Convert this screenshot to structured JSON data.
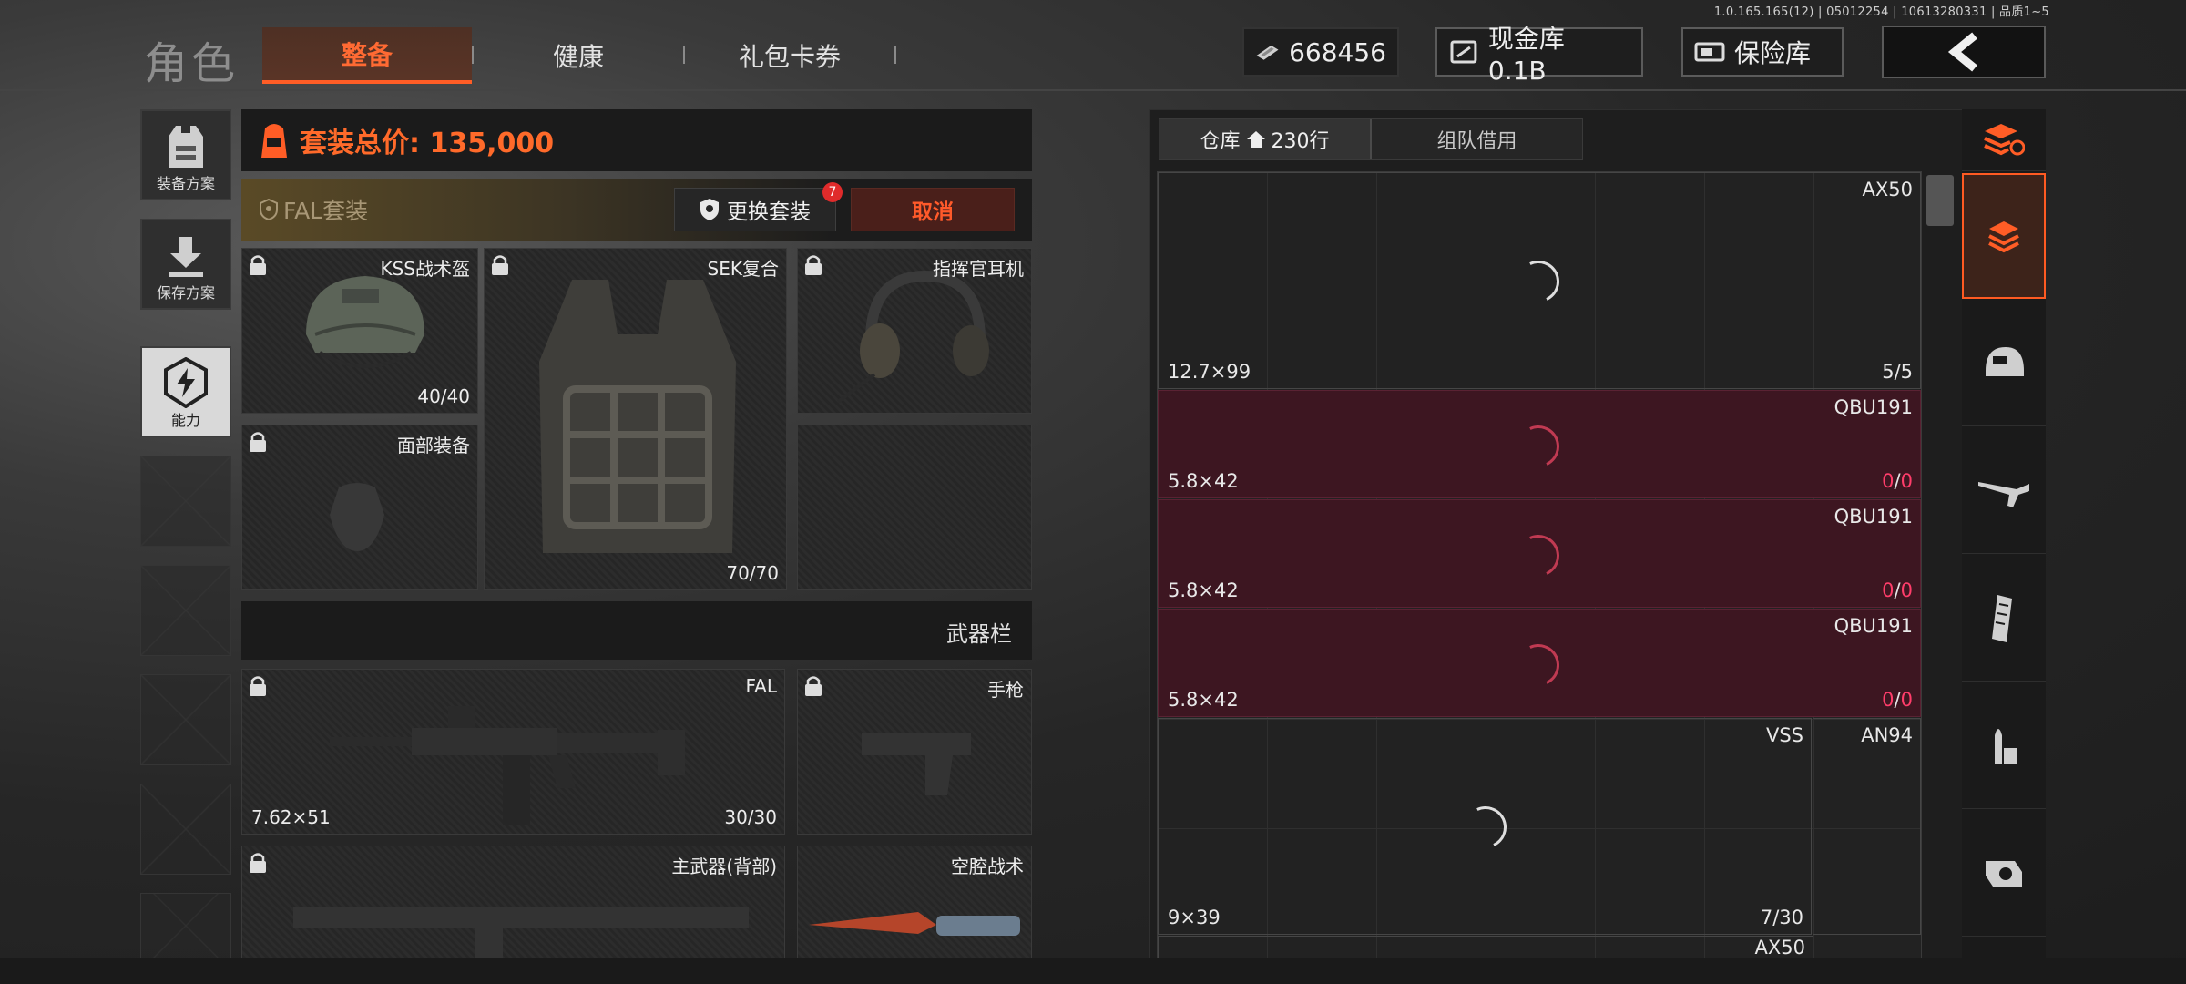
{
  "version": "1.0.165.165(12) | 05012254 | 10613280331 | 品质1~5",
  "nav": {
    "title": "角色",
    "tabs": [
      {
        "label": "整备",
        "active": true
      },
      {
        "label": "健康",
        "active": false
      },
      {
        "label": "礼包卡券",
        "active": false
      }
    ]
  },
  "currency": {
    "money": "668456",
    "cash_vault": "现金库 0.1B",
    "safe": "保险库"
  },
  "side_buttons": [
    {
      "label": "装备方案",
      "icon": "vest-icon"
    },
    {
      "label": "保存方案",
      "icon": "download-icon"
    },
    {
      "label": "能力",
      "icon": "lightning-icon"
    }
  ],
  "loadout": {
    "total_label": "套装总价: 135,000",
    "suite_name": "FAL套装",
    "swap_label": "更换套装",
    "swap_badge": "7",
    "cancel_label": "取消",
    "weapon_bar": "武器栏",
    "slots": {
      "helmet": {
        "label": "KSS战术盔",
        "count": "40/40"
      },
      "armor": {
        "label": "SEK复合",
        "count": "70/70"
      },
      "headset": {
        "label": "指挥官耳机"
      },
      "face": {
        "label": "面部装备"
      },
      "primary": {
        "label": "FAL",
        "caliber": "7.62×51",
        "count": "30/30"
      },
      "pistol": {
        "label": "手枪"
      },
      "backup": {
        "label": "主武器(背部)"
      },
      "melee": {
        "label": "空腔战术"
      }
    }
  },
  "storage": {
    "tabs": [
      {
        "label": "仓库",
        "extra": "230行",
        "active": true
      },
      {
        "label": "组队借用",
        "active": false
      }
    ],
    "items": [
      {
        "name": "AX50",
        "caliber": "12.7×99",
        "qty": "5/5"
      },
      {
        "name": "QBU191",
        "caliber": "5.8×42",
        "qty_a": "0",
        "qty_sep": "/",
        "qty_b": "0"
      },
      {
        "name": "QBU191",
        "caliber": "5.8×42",
        "qty_a": "0",
        "qty_sep": "/",
        "qty_b": "0"
      },
      {
        "name": "QBU191",
        "caliber": "5.8×42",
        "qty_a": "0",
        "qty_sep": "/",
        "qty_b": "0"
      },
      {
        "name": "VSS",
        "caliber": "9×39",
        "qty": "7/30"
      },
      {
        "name": "AN94"
      },
      {
        "name": "AX50"
      }
    ]
  },
  "categories": [
    "all-items-icon",
    "backpack-layers-icon",
    "helmet-icon",
    "rifle-icon",
    "magazine-icon",
    "ammo-icon",
    "scope-icon"
  ],
  "colors": {
    "accent": "#ff5d26",
    "danger": "#ff3d6a",
    "panel": "#1e1e1e"
  }
}
